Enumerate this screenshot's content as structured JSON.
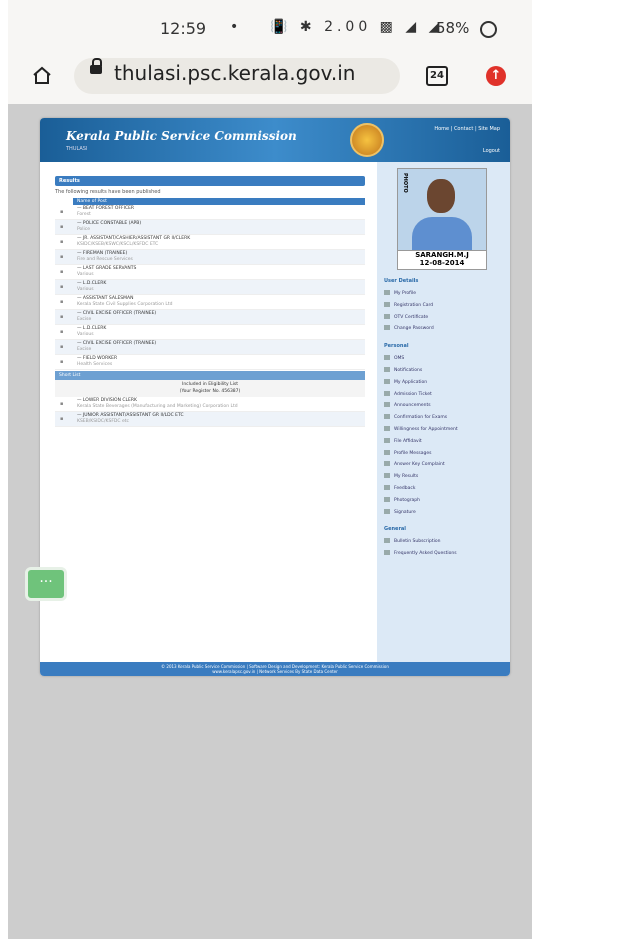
{
  "status_bar": {
    "time": "12:59",
    "dot": "•",
    "icons": "📳 ✱ 2.00 ▩ ◢ ◢",
    "battery": "58%"
  },
  "browser": {
    "url": "thulasi.psc.kerala.gov.in",
    "tab_count": "24"
  },
  "site": {
    "logo": "Kerala Public Service Commission",
    "logo_sub": "THULASI",
    "top_links": "Home | Contact | Site Map",
    "user_info": "Logout",
    "results_heading": "Results",
    "intro": "The following results have been published",
    "column_header": "Name of Post",
    "rows": [
      {
        "title": "— BEAT FOREST OFFICER",
        "subtitle": "Forest"
      },
      {
        "title": "— POLICE CONSTABLE (APB)",
        "subtitle": "Police"
      },
      {
        "title": "— JR. ASSISTANT/CASHIER/ASSISTANT GR II/CLERK",
        "subtitle": "KSIDC/KSEB/KSWC/KSCL/KSFDC ETC"
      },
      {
        "title": "— FIREMAN (TRAINEE)",
        "subtitle": "Fire and Rescue Services"
      },
      {
        "title": "— LAST GRADE SERVANTS",
        "subtitle": "Various"
      },
      {
        "title": "— L.D.CLERK",
        "subtitle": "Various"
      },
      {
        "title": "— ASSISTANT SALESMAN",
        "subtitle": "Kerala State Civil Supplies Corporation Ltd"
      },
      {
        "title": "— CIVIL EXCISE OFFICER (TRAINEE)",
        "subtitle": "Excise"
      },
      {
        "title": "— L.D.CLERK",
        "subtitle": "Various"
      },
      {
        "title": "— CIVIL EXCISE OFFICER (TRAINEE)",
        "subtitle": "Excise"
      },
      {
        "title": "— FIELD WORKER",
        "subtitle": "Health Services"
      }
    ],
    "short_list": "Short List",
    "included_line1": "Included in Eligibility List",
    "included_line2": "(Your Register No. 456387)",
    "rows2": [
      {
        "title": "— LOWER DIVISION CLERK",
        "subtitle": "Kerala State Beverages (Manufacturing and Marketing) Corporation Ltd"
      },
      {
        "title": "— JUNIOR ASSISTANT/ASSISTANT GR II/LDC ETC",
        "subtitle": "KSEB/KSIDC/KSFDC etc"
      }
    ],
    "profile_label": "PHOTO",
    "name": "SARANGH.M.J",
    "date": "12-08-2014",
    "sidebar_sections": [
      {
        "title": "User Details",
        "items": [
          "My Profile",
          "Registration Card",
          "OTV Certificate",
          "Change Password"
        ]
      },
      {
        "title": "Personal",
        "items": [
          "OMS",
          "Notifications",
          "My Application",
          "Admission Ticket",
          "Announcements",
          "Confirmation for Exams",
          "Willingness for Appointment",
          "File Affidavit",
          "Profile Messages",
          "Answer Key Complaint",
          "My Results",
          "Feedback",
          "Photograph",
          "Signature"
        ]
      },
      {
        "title": "General",
        "items": [
          "Bulletin Subscription",
          "Frequently Asked Questions"
        ]
      }
    ],
    "footer_line1": "© 2013 Kerala Public Service Commission | Software Design and Development: Kerala Public Service Commission",
    "footer_line2": "www.keralapsc.gov.in | Network Services By State Data Center"
  },
  "floating_button": "···"
}
